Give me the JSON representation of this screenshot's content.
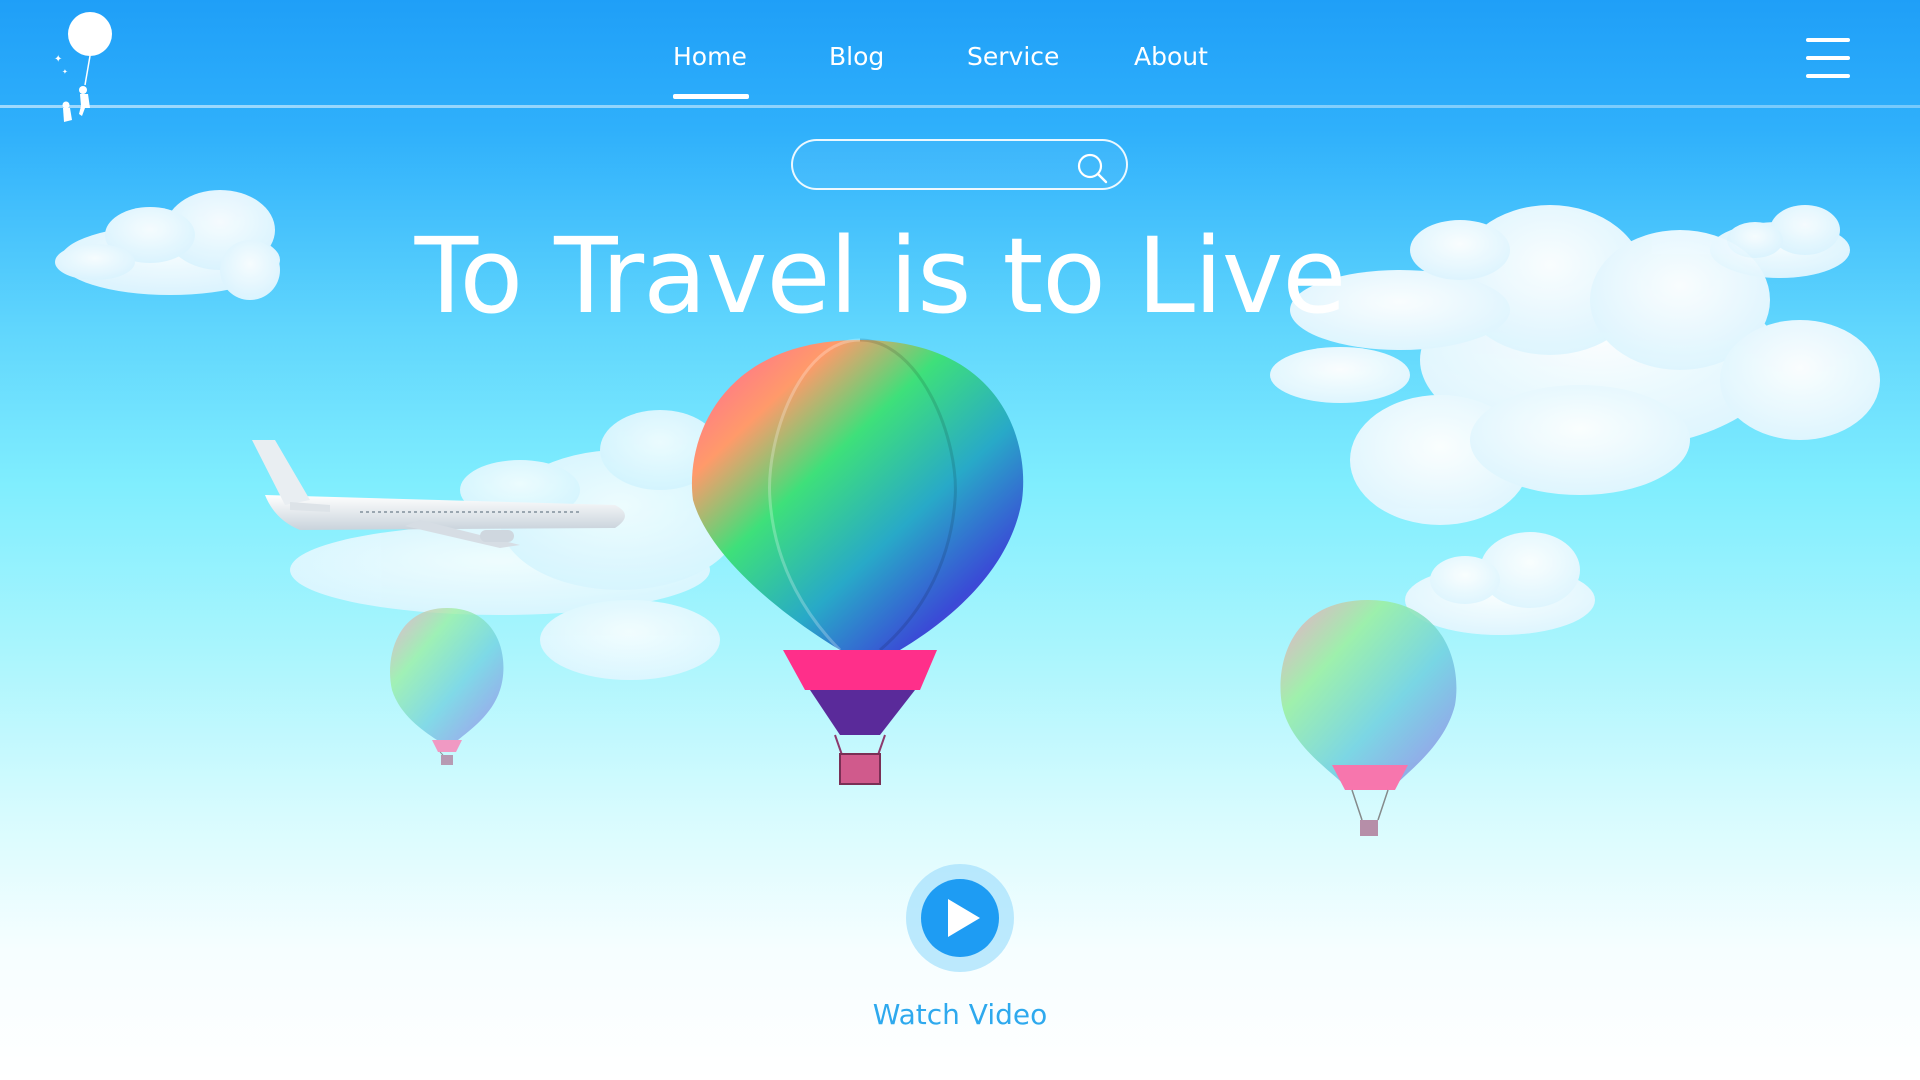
{
  "nav": {
    "items": [
      {
        "label": "Home",
        "active": true
      },
      {
        "label": "Blog",
        "active": false
      },
      {
        "label": "Service",
        "active": false
      },
      {
        "label": "About",
        "active": false
      }
    ]
  },
  "search": {
    "placeholder": "",
    "value": ""
  },
  "hero": {
    "title": "To Travel is to Live"
  },
  "video": {
    "label": "Watch Video"
  },
  "icons": {
    "logo": "balloon-child-logo-icon",
    "menu": "hamburger-menu-icon",
    "search": "search-icon",
    "play": "play-icon"
  },
  "colors": {
    "sky_top": "#1f9ff8",
    "sky_bottom": "#ffffff",
    "accent": "#1e9cf3",
    "watch_text": "#2ea9ee"
  }
}
